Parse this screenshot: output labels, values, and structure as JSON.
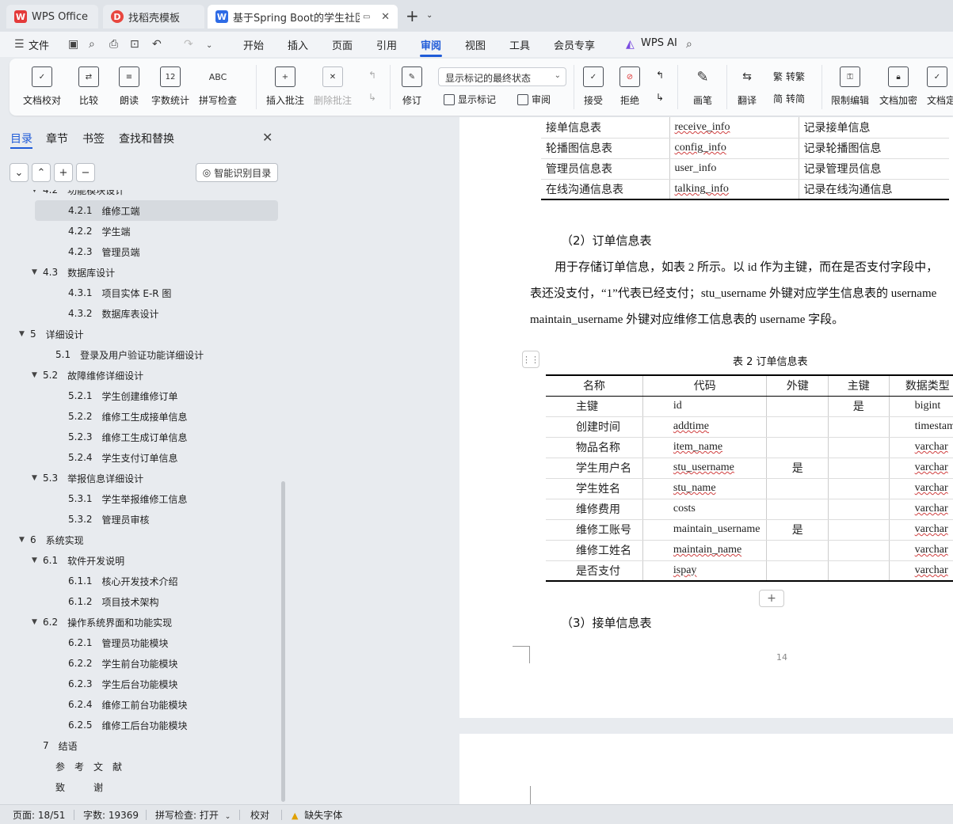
{
  "tabs": [
    {
      "label": "WPS Office",
      "icon": "W"
    },
    {
      "label": "找稻壳模板",
      "icon": "D"
    },
    {
      "label": "基于Spring Boot的学生社区故障维修预约系统",
      "icon": "W"
    }
  ],
  "menu": {
    "file": "文件",
    "items": [
      "开始",
      "插入",
      "页面",
      "引用",
      "审阅",
      "视图",
      "工具",
      "会员专享"
    ],
    "ai": "WPS AI"
  },
  "ribbon": {
    "doc_check": "文档校对",
    "compare": "比较",
    "read_aloud": "朗读",
    "word_count": "字数统计",
    "spell_check": "拼写检查",
    "insert_comment": "插入批注",
    "delete_comment": "删除批注",
    "revise": "修订",
    "display_state": "显示标记的最终状态",
    "show_marks": "显示标记",
    "review": "审阅",
    "accept": "接受",
    "reject": "拒绝",
    "pen": "画笔",
    "translate": "翻译",
    "to_trad": "转繁",
    "to_simp": "转简",
    "restrict_edit": "限制编辑",
    "encrypt": "文档加密",
    "finalize": "文档定稿"
  },
  "nav": {
    "tabs": [
      "目录",
      "章节",
      "书签",
      "查找和替换"
    ],
    "ai_button": "智能识别目录",
    "toc": [
      {
        "num": "4.2",
        "label": "功能模块设计",
        "level": 1,
        "caret": true
      },
      {
        "num": "4.2.1",
        "label": "维修工端",
        "level": 2,
        "selected": true
      },
      {
        "num": "4.2.2",
        "label": "学生端",
        "level": 2
      },
      {
        "num": "4.2.3",
        "label": "管理员端",
        "level": 2
      },
      {
        "num": "4.3",
        "label": "数据库设计",
        "level": 1,
        "caret": true
      },
      {
        "num": "4.3.1",
        "label": "项目实体 E-R 图",
        "level": 2
      },
      {
        "num": "4.3.2",
        "label": "数据库表设计",
        "level": 2
      },
      {
        "num": "5",
        "label": "详细设计",
        "level": 0,
        "caret": true
      },
      {
        "num": "5.1",
        "label": "登录及用户验证功能详细设计",
        "level": 1
      },
      {
        "num": "5.2",
        "label": "故障维修详细设计",
        "level": 1,
        "caret": true
      },
      {
        "num": "5.2.1",
        "label": "学生创建维修订单",
        "level": 2
      },
      {
        "num": "5.2.2",
        "label": "维修工生成接单信息",
        "level": 2
      },
      {
        "num": "5.2.3",
        "label": "维修工生成订单信息",
        "level": 2
      },
      {
        "num": "5.2.4",
        "label": "学生支付订单信息",
        "level": 2
      },
      {
        "num": "5.3",
        "label": "举报信息详细设计",
        "level": 1,
        "caret": true
      },
      {
        "num": "5.3.1",
        "label": "学生举报维修工信息",
        "level": 2
      },
      {
        "num": "5.3.2",
        "label": "管理员审核",
        "level": 2
      },
      {
        "num": "6",
        "label": "系统实现",
        "level": 0,
        "caret": true
      },
      {
        "num": "6.1",
        "label": "软件开发说明",
        "level": 1,
        "caret": true
      },
      {
        "num": "6.1.1",
        "label": "核心开发技术介绍",
        "level": 2
      },
      {
        "num": "6.1.2",
        "label": "项目技术架构",
        "level": 2
      },
      {
        "num": "6.2",
        "label": "操作系统界面和功能实现",
        "level": 1,
        "caret": true
      },
      {
        "num": "6.2.1",
        "label": "管理员功能模块",
        "level": 2
      },
      {
        "num": "6.2.2",
        "label": "学生前台功能模块",
        "level": 2
      },
      {
        "num": "6.2.3",
        "label": "学生后台功能模块",
        "level": 2
      },
      {
        "num": "6.2.4",
        "label": "维修工前台功能模块",
        "level": 2
      },
      {
        "num": "6.2.5",
        "label": "维修工后台功能模块",
        "level": 2
      },
      {
        "num": "7",
        "label": "结语",
        "level": 0
      },
      {
        "num": "",
        "label": "参　考　文　献",
        "level": 0
      },
      {
        "num": "",
        "label": "致　　　谢",
        "level": 0
      }
    ]
  },
  "doc": {
    "table1": [
      [
        "接单信息表",
        "receive_info",
        "记录接单信息"
      ],
      [
        "轮播图信息表",
        "config_info",
        "记录轮播图信息"
      ],
      [
        "管理员信息表",
        "user_info",
        "记录管理员信息"
      ],
      [
        "在线沟通信息表",
        "talking_info",
        "记录在线沟通信息"
      ]
    ],
    "section_heading": "（2）订单信息表",
    "para_line1": "用于存储订单信息，如表 2 所示。以 id 作为主键，而在是否支付字段中，",
    "para_line2": "表还没支付，“1”代表已经支付；stu_username 外键对应学生信息表的 username",
    "para_line3": "maintain_username 外键对应维修工信息表的 username 字段。",
    "table2_caption": "表 2  订单信息表",
    "table2_headers": [
      "名称",
      "代码",
      "外键",
      "主键",
      "数据类型"
    ],
    "table2_rows": [
      [
        "主键",
        "id",
        "",
        "是",
        "bigint"
      ],
      [
        "创建时间",
        "addtime",
        "",
        "",
        "timestamp"
      ],
      [
        "物品名称",
        "item_name",
        "",
        "",
        "varchar"
      ],
      [
        "学生用户名",
        "stu_username",
        "是",
        "",
        "varchar"
      ],
      [
        "学生姓名",
        "stu_name",
        "",
        "",
        "varchar"
      ],
      [
        "维修费用",
        "costs",
        "",
        "",
        "varchar"
      ],
      [
        "维修工账号",
        "maintain_username",
        "是",
        "",
        "varchar"
      ],
      [
        "维修工姓名",
        "maintain_name",
        "",
        "",
        "varchar"
      ],
      [
        "是否支付",
        "ispay",
        "",
        "",
        "varchar"
      ]
    ],
    "next_heading": "（3）接单信息表",
    "page_number": "14"
  },
  "status": {
    "page": "页面: 18/51",
    "words": "字数: 19369",
    "spell": "拼写检查: 打开",
    "proof": "校对",
    "missing_font": "缺失字体"
  }
}
